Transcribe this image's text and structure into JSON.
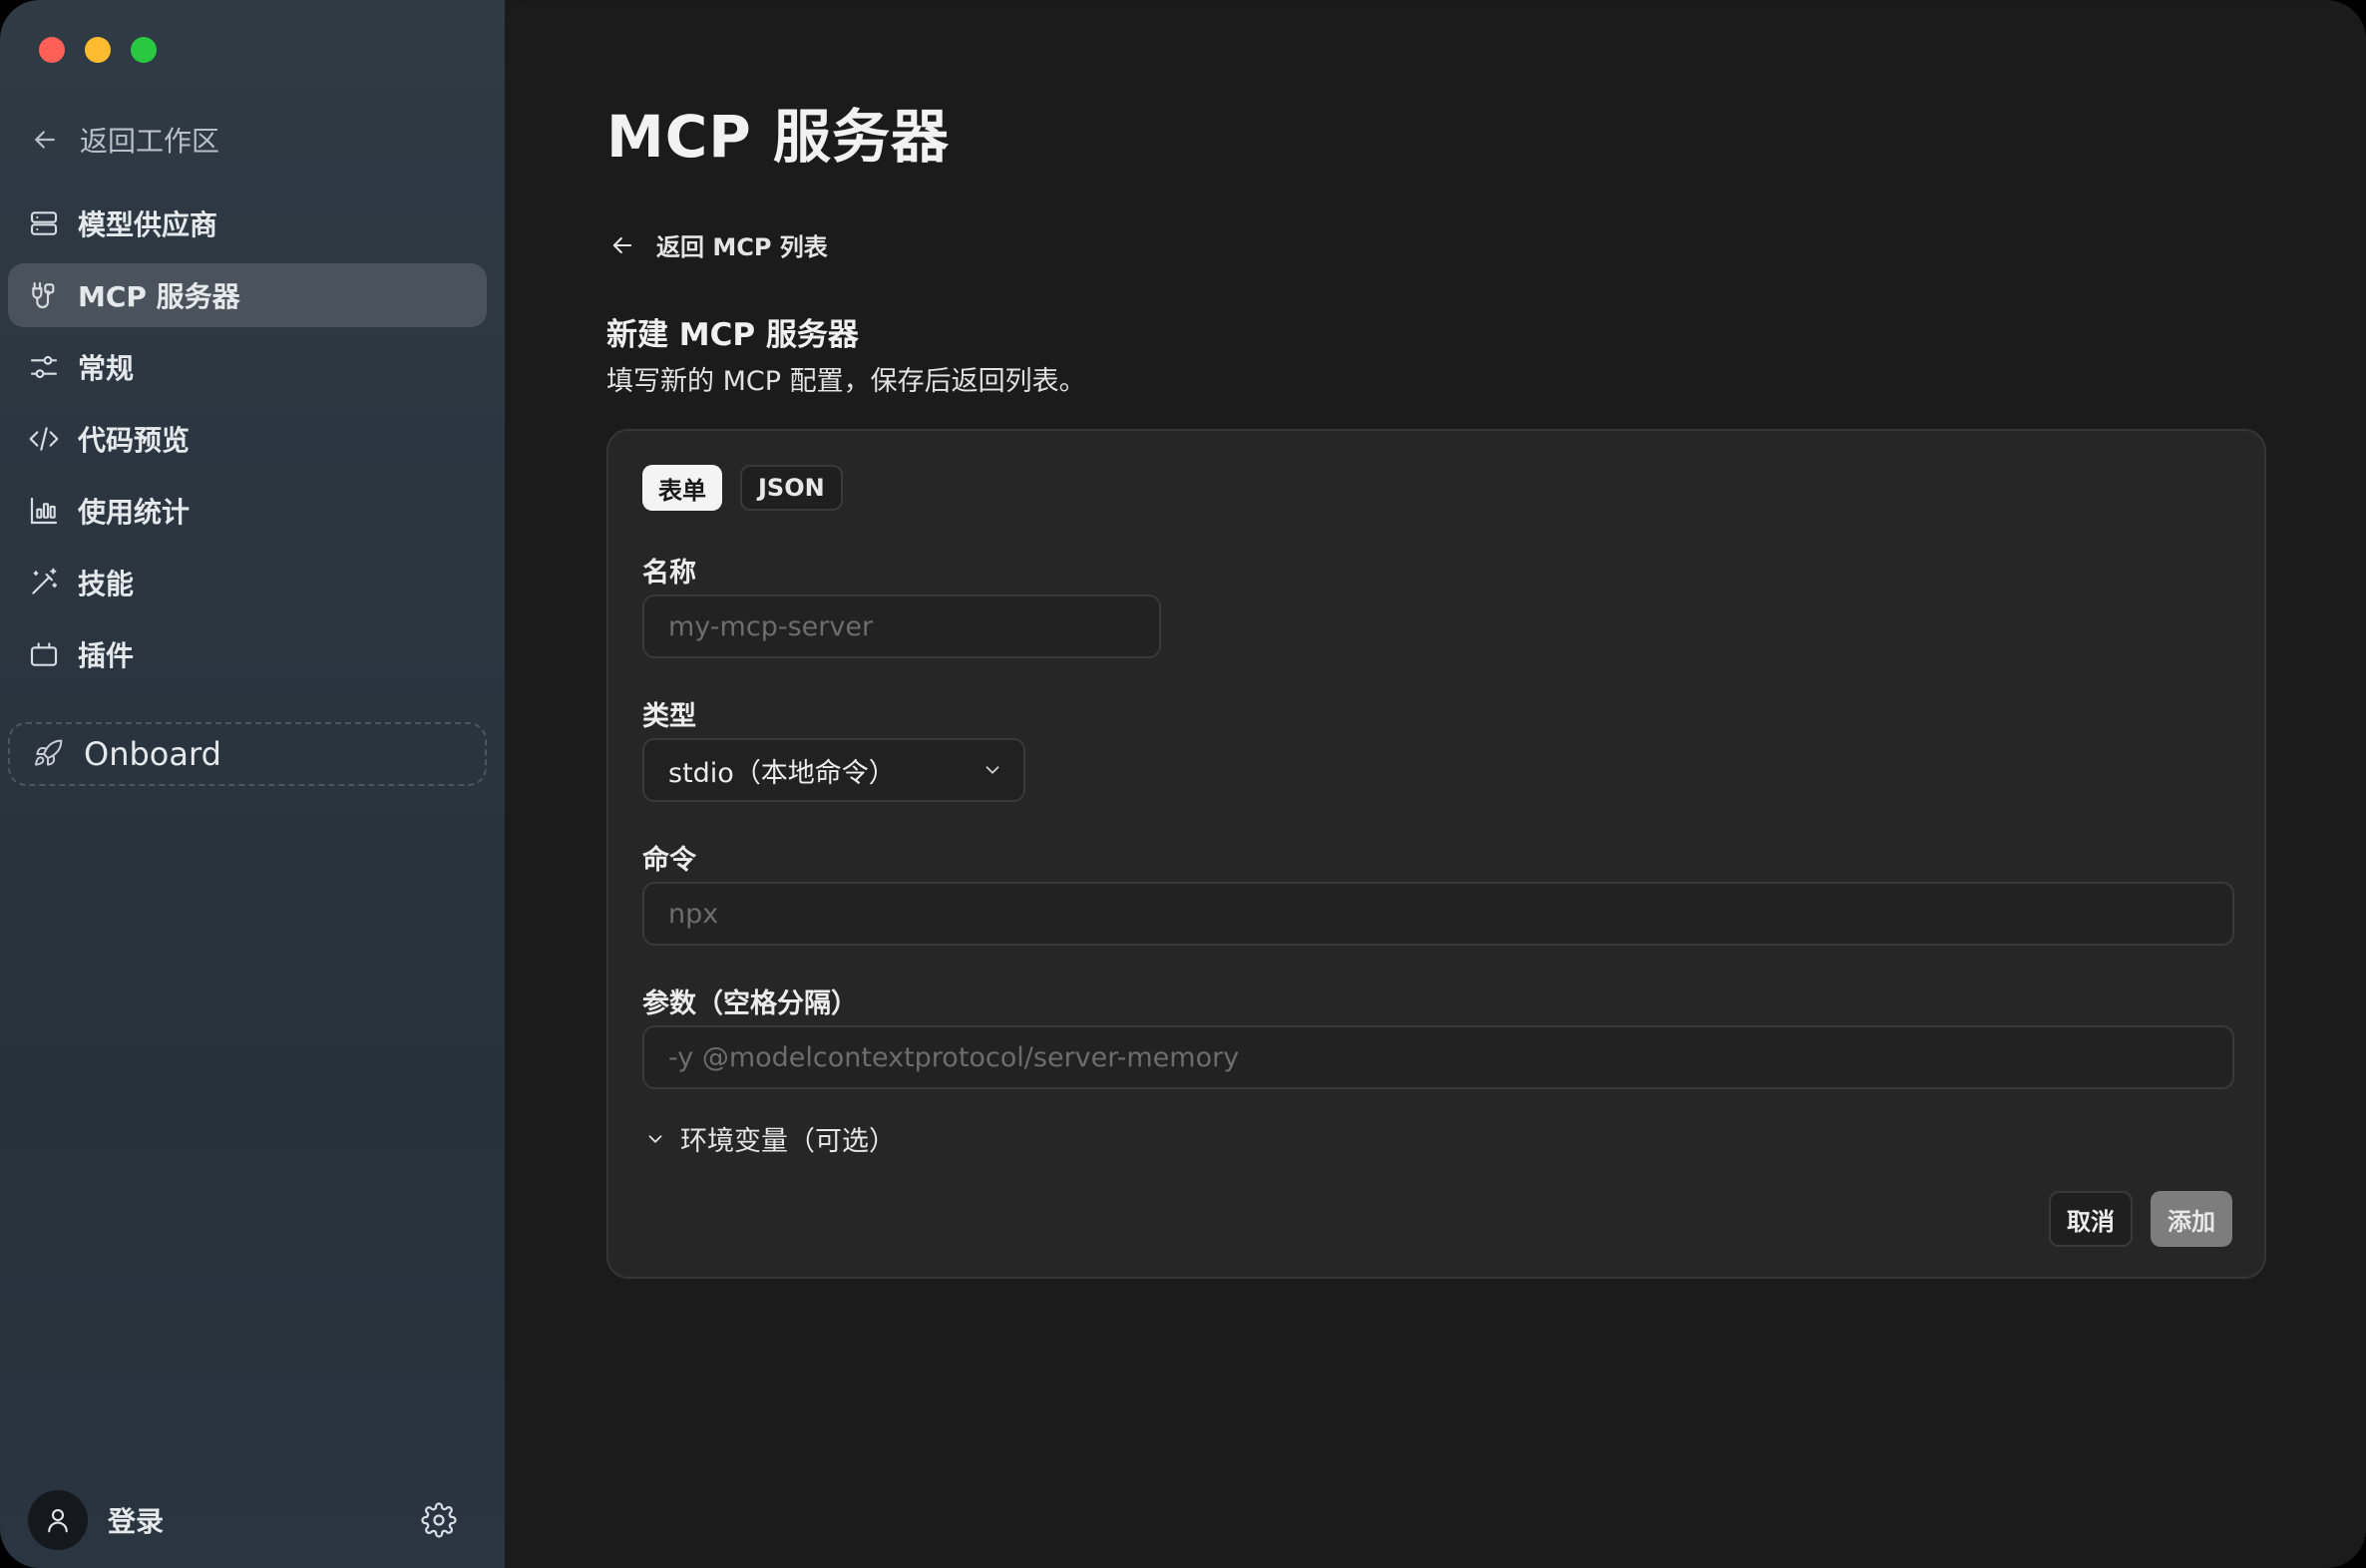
{
  "sidebar": {
    "back_label": "返回工作区",
    "items": [
      {
        "label": "模型供应商",
        "icon": "server-icon"
      },
      {
        "label": "MCP 服务器",
        "icon": "plug-icon"
      },
      {
        "label": "常规",
        "icon": "sliders-icon"
      },
      {
        "label": "代码预览",
        "icon": "code-icon"
      },
      {
        "label": "使用统计",
        "icon": "bar-chart-icon"
      },
      {
        "label": "技能",
        "icon": "wand-icon"
      },
      {
        "label": "插件",
        "icon": "plugin-icon"
      }
    ],
    "onboard_label": "Onboard",
    "login_label": "登录"
  },
  "main": {
    "title": "MCP 服务器",
    "back_label": "返回 MCP 列表",
    "section_title": "新建 MCP 服务器",
    "section_desc": "填写新的 MCP 配置，保存后返回列表。",
    "tabs": [
      {
        "label": "表单"
      },
      {
        "label": "JSON"
      }
    ],
    "form": {
      "name_label": "名称",
      "name_placeholder": "my-mcp-server",
      "type_label": "类型",
      "type_value": "stdio（本地命令）",
      "command_label": "命令",
      "command_placeholder": "npx",
      "args_label": "参数（空格分隔）",
      "args_placeholder": "-y @modelcontextprotocol/server-memory",
      "env_label": "环境变量（可选）"
    },
    "buttons": {
      "cancel": "取消",
      "add": "添加"
    }
  },
  "colors": {
    "traffic_red": "#fe5f57",
    "traffic_yellow": "#febc2e",
    "traffic_green": "#28c840",
    "active_nav": "#4a535c",
    "add_button": "#7d7d7d"
  }
}
